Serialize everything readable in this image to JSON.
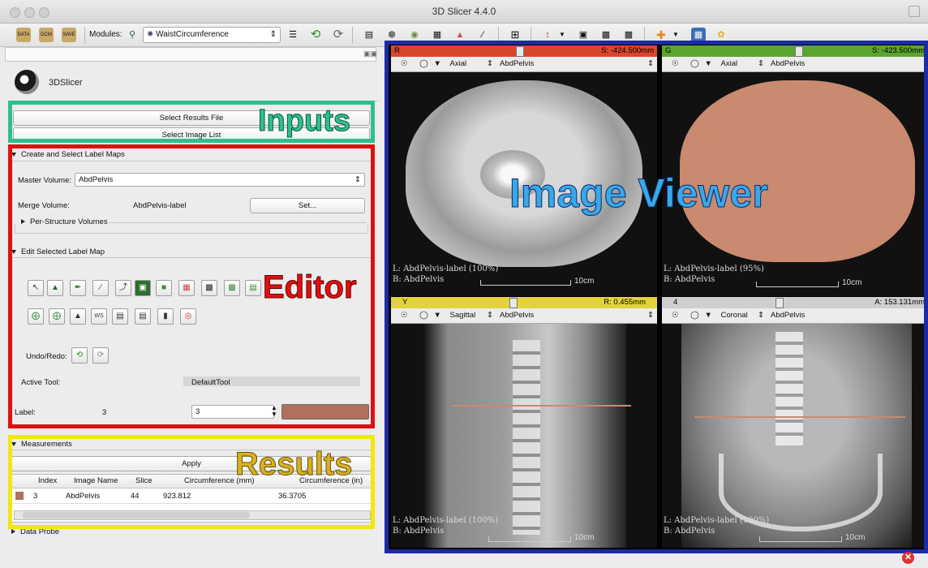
{
  "window": {
    "title": "3D Slicer 4.4.0"
  },
  "toolbar": {
    "data_label": "DATA",
    "dcm_label": "DCM",
    "save_label": "SAVE",
    "modules_label": "Modules:",
    "module_value": "WaistCircumference"
  },
  "logo": {
    "text": "3DSlicer"
  },
  "inputs": {
    "select_results_file": "Select Results File",
    "select_image_list": "Select Image List"
  },
  "label_maps": {
    "header": "Create and Select Label Maps",
    "master_volume_label": "Master Volume:",
    "master_volume_value": "AbdPelvis",
    "merge_volume_label": "Merge Volume:",
    "merge_volume_value": "AbdPelvis-label",
    "set_button": "Set...",
    "per_structure": "Per-Structure Volumes"
  },
  "editor": {
    "header": "Edit Selected Label Map",
    "undo_redo_label": "Undo/Redo:",
    "active_tool_label": "Active Tool:",
    "active_tool_value": "DefaultTool",
    "label_label": "Label:",
    "label_index": "3",
    "label_value": "3",
    "label_color": "#b0705a"
  },
  "measurements": {
    "header": "Measurements",
    "apply": "Apply",
    "columns": [
      "Index",
      "Image Name",
      "Slice",
      "Circumference (mm)",
      "Circumference (in)"
    ],
    "row": {
      "index": "3",
      "image": "AbdPelvis",
      "slice": "44",
      "circ_mm": "923.812",
      "circ_in": "36.3705"
    }
  },
  "data_probe": {
    "header": "Data Probe"
  },
  "annotations": {
    "inputs": "Inputs",
    "editor": "Editor",
    "results": "Results",
    "image_viewer": "Image Viewer"
  },
  "colors": {
    "inputs_frame": "#2fbf8f",
    "editor_frame": "#e01010",
    "results_frame": "#f2e80a",
    "viewer_frame": "#1a2aa8",
    "red_slice": "#d9472b",
    "green_slice": "#5aa62e",
    "yellow_slice": "#e3d23c",
    "label_overlay": "#c98a6f"
  },
  "views": {
    "red": {
      "letter": "R",
      "offset": "S: -424.500mm",
      "orientation": "Axial",
      "volume": "AbdPelvis",
      "corner1": "L: AbdPelvis-label (100%)",
      "corner2": "B: AbdPelvis",
      "scale": "10cm"
    },
    "green": {
      "letter": "G",
      "offset": "S: -423.500mm",
      "orientation": "Axial",
      "volume": "AbdPelvis",
      "corner1": "L: AbdPelvis-label (95%)",
      "corner2": "B: AbdPelvis",
      "scale": "10cm"
    },
    "yellow": {
      "letter": "Y",
      "offset": "R: 0.455mm",
      "orientation": "Sagittal",
      "volume": "AbdPelvis",
      "corner1": "L: AbdPelvis-label (100%)",
      "corner2": "B: AbdPelvis",
      "scale": "10cm"
    },
    "slice4": {
      "letter": "4",
      "offset": "A: 153.131mm",
      "orientation": "Coronal",
      "volume": "AbdPelvis",
      "corner1": "L: AbdPelvis-label (100%)",
      "corner2": "B: AbdPelvis",
      "scale": "10cm"
    }
  }
}
